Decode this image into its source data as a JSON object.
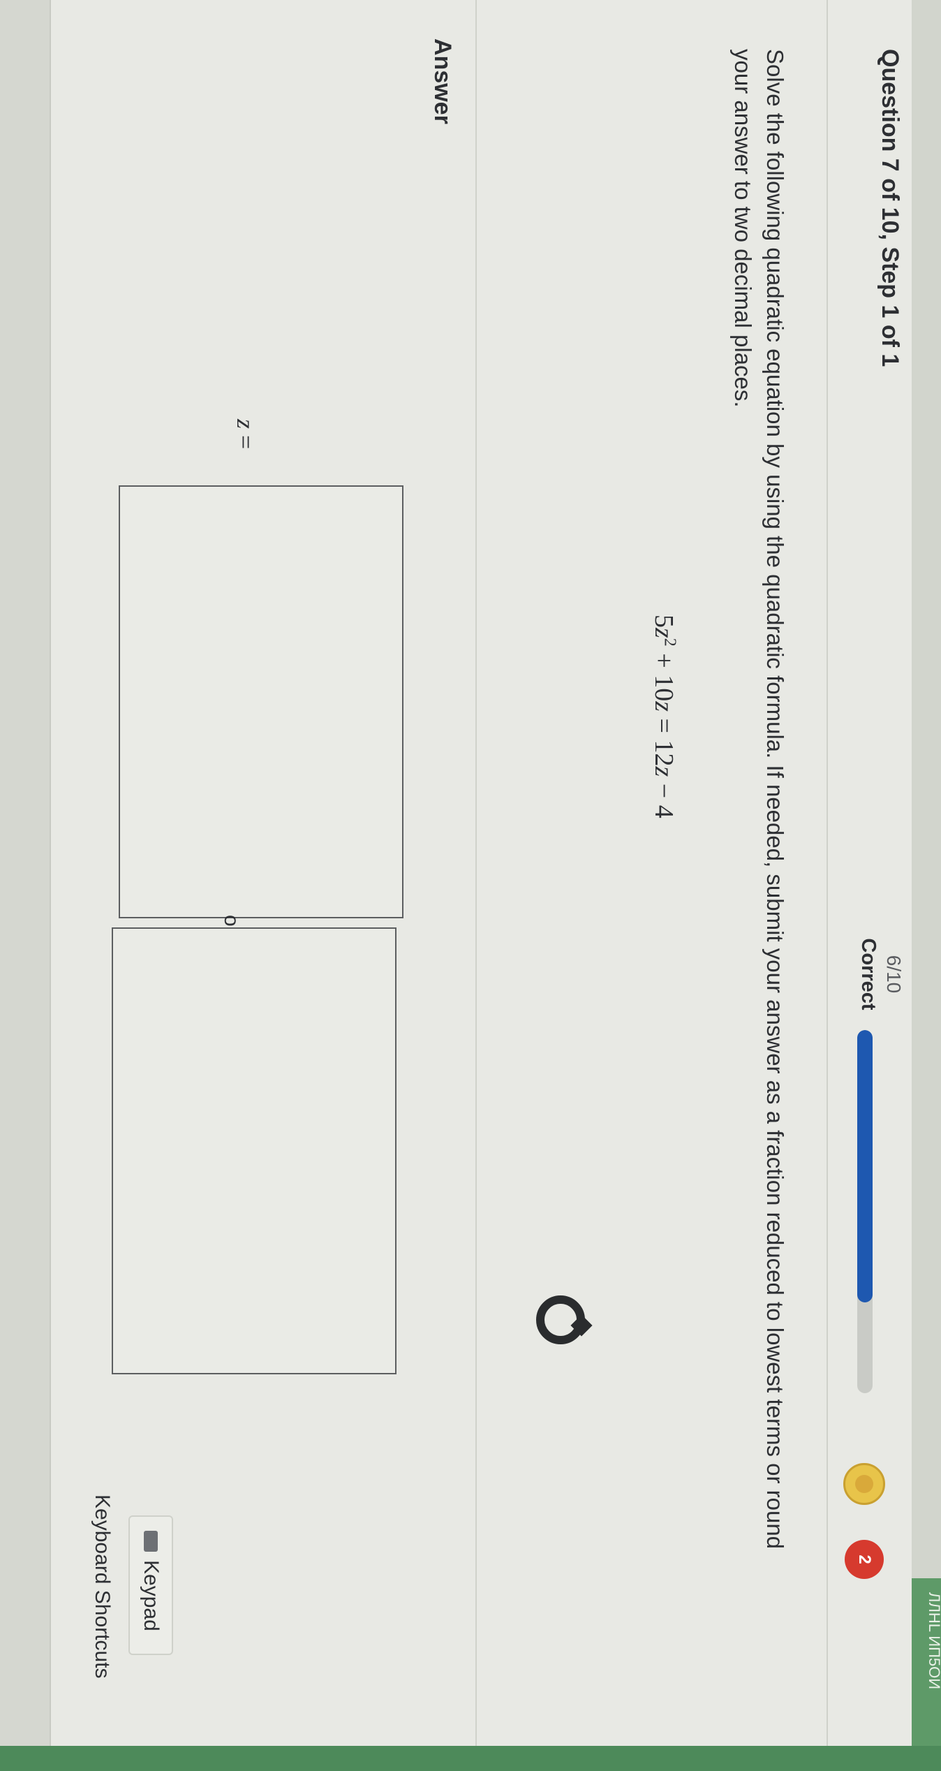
{
  "window": {
    "title_fragment": "ЛЛНL ИП5ОИ"
  },
  "header": {
    "question_label": "Question 7 of 10, Step 1 of 1",
    "score": "6/10",
    "score_status": "Correct",
    "progress": 0.75,
    "heart_count": "2"
  },
  "question": {
    "prompt": "Solve the following quadratic equation by using the quadratic formula. If needed, submit your answer as a fraction reduced to lowest terms or round your answer to two decimal places.",
    "equation": {
      "coef_a": "5",
      "var": "z",
      "exponent": "2",
      "plus": "+",
      "coef_b": "10",
      "equals": "=",
      "coef_c": "12",
      "minus": "−",
      "constant": "4"
    }
  },
  "answer": {
    "label": "Answer",
    "variable": "z",
    "equals": "=",
    "separator": "or",
    "value_1": "",
    "value_2": ""
  },
  "tools": {
    "keypad_label": "Keypad",
    "keyboard_shortcuts_label": "Keyboard Shortcuts"
  },
  "colors": {
    "progress_fill": "#1e58b0",
    "heart": "#d63a2e",
    "coin": "#e8c44a",
    "accent_green": "#4d8a5a"
  },
  "icons": [
    "coin-icon",
    "heart-icon",
    "loader-icon",
    "keypad-icon"
  ]
}
